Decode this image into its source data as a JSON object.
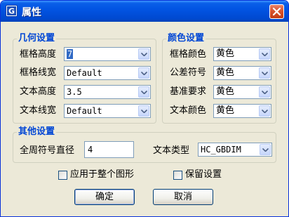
{
  "window": {
    "title": "属性"
  },
  "geometry": {
    "title": "几何设置",
    "rows": [
      {
        "label": "框格高度",
        "value": "7"
      },
      {
        "label": "框格线宽",
        "value": "Default"
      },
      {
        "label": "文本高度",
        "value": "3.5"
      },
      {
        "label": "文本线宽",
        "value": "Default"
      }
    ]
  },
  "colors": {
    "title": "颜色设置",
    "rows": [
      {
        "label": "框格颜色",
        "value": "黄色"
      },
      {
        "label": "公差符号",
        "value": "黄色"
      },
      {
        "label": "基准要求",
        "value": "黄色"
      },
      {
        "label": "文本颜色",
        "value": "黄色"
      }
    ]
  },
  "other": {
    "title": "其他设置",
    "diameter_label": "全周符号直径",
    "diameter_value": "4",
    "text_type_label": "文本类型",
    "text_type_value": "HC_GBDIM"
  },
  "options": {
    "apply_all_label": "应用于整个图形",
    "apply_all_checked": false,
    "keep_label": "保留设置",
    "keep_checked": false
  },
  "buttons": {
    "ok": "确定",
    "cancel": "取消"
  },
  "icons": {
    "app": "cad-app-icon",
    "close": "close-icon",
    "dropdown": "chevron-down-icon"
  }
}
